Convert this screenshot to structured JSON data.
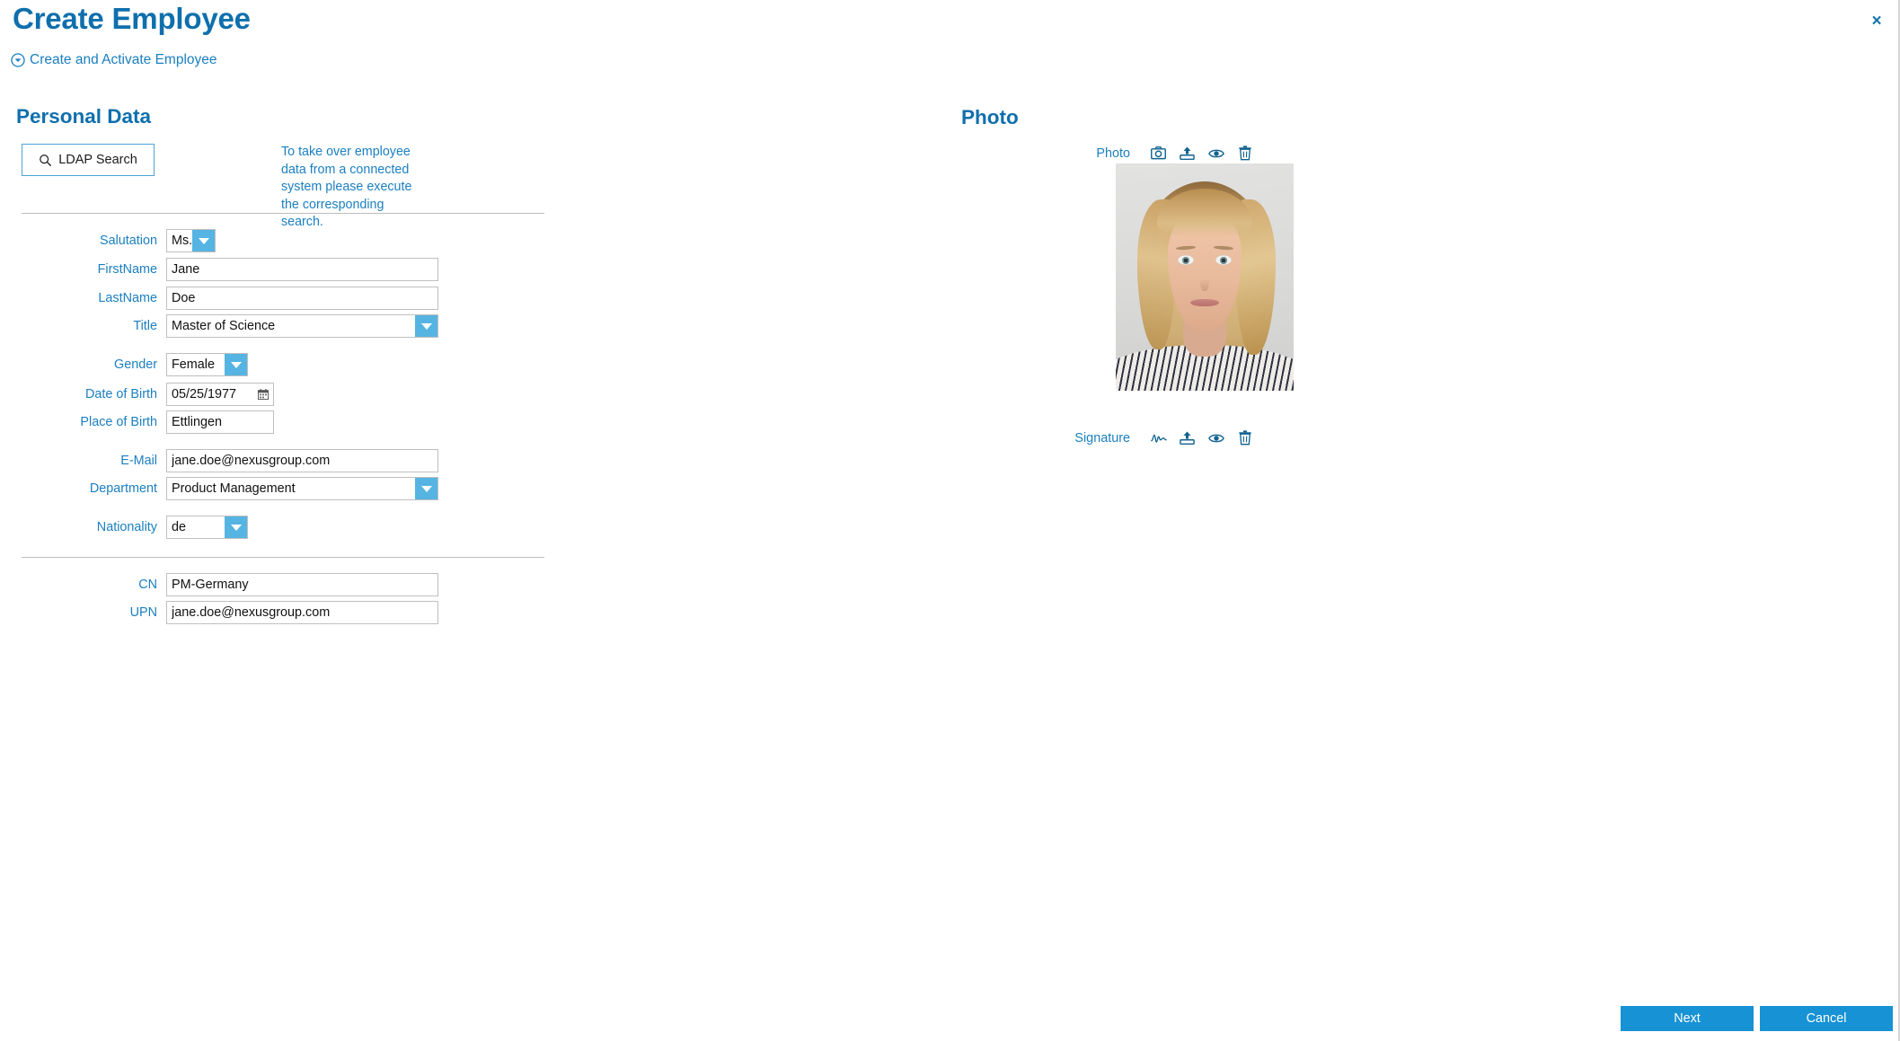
{
  "header": {
    "title": "Create Employee",
    "subtitle": "Create and Activate Employee",
    "close_label": "×"
  },
  "personal": {
    "heading": "Personal Data",
    "ldap_button": "LDAP Search",
    "hint": "To take over employee data from a connected system please execute the corresponding search.",
    "fields": [
      {
        "label": "Salutation",
        "value": "Ms.",
        "type": "select"
      },
      {
        "label": "FirstName",
        "value": "Jane",
        "type": "text"
      },
      {
        "label": "LastName",
        "value": "Doe",
        "type": "text"
      },
      {
        "label": "Title",
        "value": "Master of Science",
        "type": "select"
      },
      {
        "label": "Gender",
        "value": "Female",
        "type": "select"
      },
      {
        "label": "Date of Birth",
        "value": "05/25/1977",
        "type": "date"
      },
      {
        "label": "Place of Birth",
        "value": "Ettlingen",
        "type": "text"
      },
      {
        "label": "E-Mail",
        "value": "jane.doe@nexusgroup.com",
        "type": "text"
      },
      {
        "label": "Department",
        "value": "Product Management",
        "type": "select"
      },
      {
        "label": "Nationality",
        "value": "de",
        "type": "select"
      },
      {
        "label": "CN",
        "value": "PM-Germany",
        "type": "text"
      },
      {
        "label": "UPN",
        "value": "jane.doe@nexusgroup.com",
        "type": "text"
      }
    ]
  },
  "photo_panel": {
    "heading": "Photo",
    "photo_label": "Photo",
    "signature_label": "Signature",
    "photo_icons": [
      "camera-icon",
      "upload-icon",
      "eye-icon",
      "trash-icon"
    ],
    "signature_icons": [
      "signature-icon",
      "upload-icon",
      "eye-icon",
      "trash-icon"
    ]
  },
  "footer": {
    "next_label": "Next",
    "cancel_label": "Cancel"
  },
  "colors": {
    "heading_blue": "#0f6fad",
    "label_blue": "#1b7fc0",
    "accent_blue": "#56b4e2",
    "button_blue": "#1792d4",
    "field_border": "#bfbfbf"
  }
}
